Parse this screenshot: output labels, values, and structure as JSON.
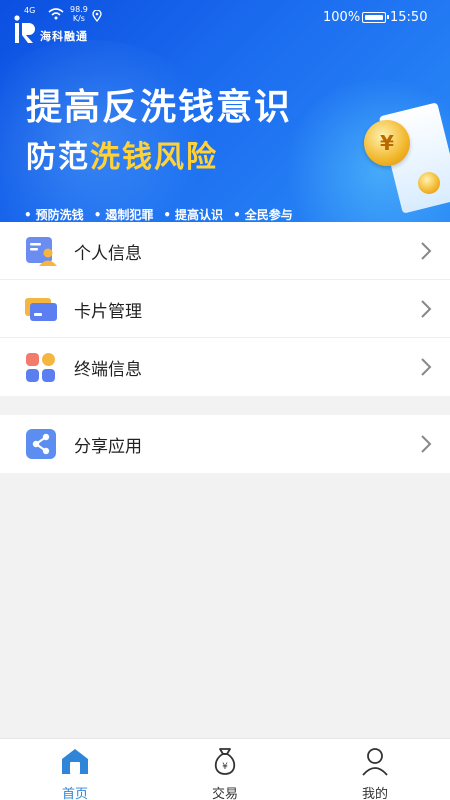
{
  "status_bar": {
    "network_type": "4G",
    "speed_value": "98.9",
    "speed_unit": "K/s",
    "battery": "100%",
    "time": "15:50"
  },
  "banner": {
    "logo_text": "海科融通",
    "headline_line1": "提高反洗钱意识",
    "headline_line2_prefix": "防范",
    "headline_line2_highlight": "洗钱风险",
    "slogans": [
      "预防洗钱",
      "遏制犯罪",
      "提高认识",
      "全民参与"
    ],
    "coin_symbol": "¥"
  },
  "menu": {
    "items": [
      {
        "label": "个人信息",
        "icon": "id-card-icon"
      },
      {
        "label": "卡片管理",
        "icon": "card-icon"
      },
      {
        "label": "终端信息",
        "icon": "apps-grid-icon"
      }
    ]
  },
  "menu2": {
    "items": [
      {
        "label": "分享应用",
        "icon": "share-icon"
      }
    ]
  },
  "bottom_nav": {
    "tabs": [
      {
        "label": "首页",
        "icon": "home-icon",
        "active": true
      },
      {
        "label": "交易",
        "icon": "money-bag-icon",
        "active": false
      },
      {
        "label": "我的",
        "icon": "user-icon",
        "active": false
      }
    ]
  },
  "colors": {
    "accent": "#2f86d8",
    "banner_blue": "#1c6df0",
    "highlight_yellow": "#ffd23a"
  }
}
